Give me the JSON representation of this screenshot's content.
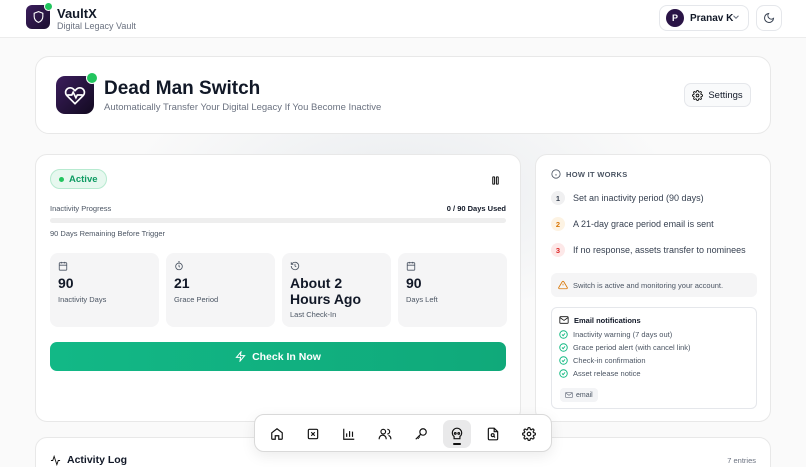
{
  "header": {
    "brand_title": "VaultX",
    "brand_subtitle": "Digital Legacy Vault",
    "user_initial": "P",
    "user_name": "Pranav K"
  },
  "hero": {
    "title": "Dead Man Switch",
    "subtitle": "Automatically Transfer Your Digital Legacy If You Become Inactive",
    "settings_label": "Settings"
  },
  "status": {
    "label": "Active",
    "progress_label": "Inactivity Progress",
    "progress_value": "0 / 90 Days Used",
    "progress_fraction": 0,
    "remaining_text": "90 Days Remaining Before Trigger"
  },
  "stats": [
    {
      "value": "90",
      "label": "Inactivity Days",
      "icon": "calendar-icon"
    },
    {
      "value": "21",
      "label": "Grace Period",
      "icon": "timer-icon"
    },
    {
      "value": "About 2 Hours Ago",
      "label": "Last Check-In",
      "icon": "history-icon"
    },
    {
      "value": "90",
      "label": "Days Left",
      "icon": "calendar-icon"
    }
  ],
  "checkin_label": "Check In Now",
  "how_it_works": {
    "title": "HOW IT WORKS",
    "steps": [
      {
        "num": "1",
        "text": "Set an inactivity period (90 days)"
      },
      {
        "num": "2",
        "text": "A 21-day grace period email is sent"
      },
      {
        "num": "3",
        "text": "If no response, assets transfer to nominees"
      }
    ],
    "notice": "Switch is active and monitoring your account.",
    "email_title": "Email notifications",
    "email_items": [
      "Inactivity warning (7 days out)",
      "Grace period alert (with cancel link)",
      "Check-in confirmation",
      "Asset release notice"
    ],
    "email_tag": "email"
  },
  "activity": {
    "title": "Activity Log",
    "count": "7 entries"
  },
  "colors": {
    "accent_green": "#10b981",
    "brand_dark": "#2a1446"
  }
}
